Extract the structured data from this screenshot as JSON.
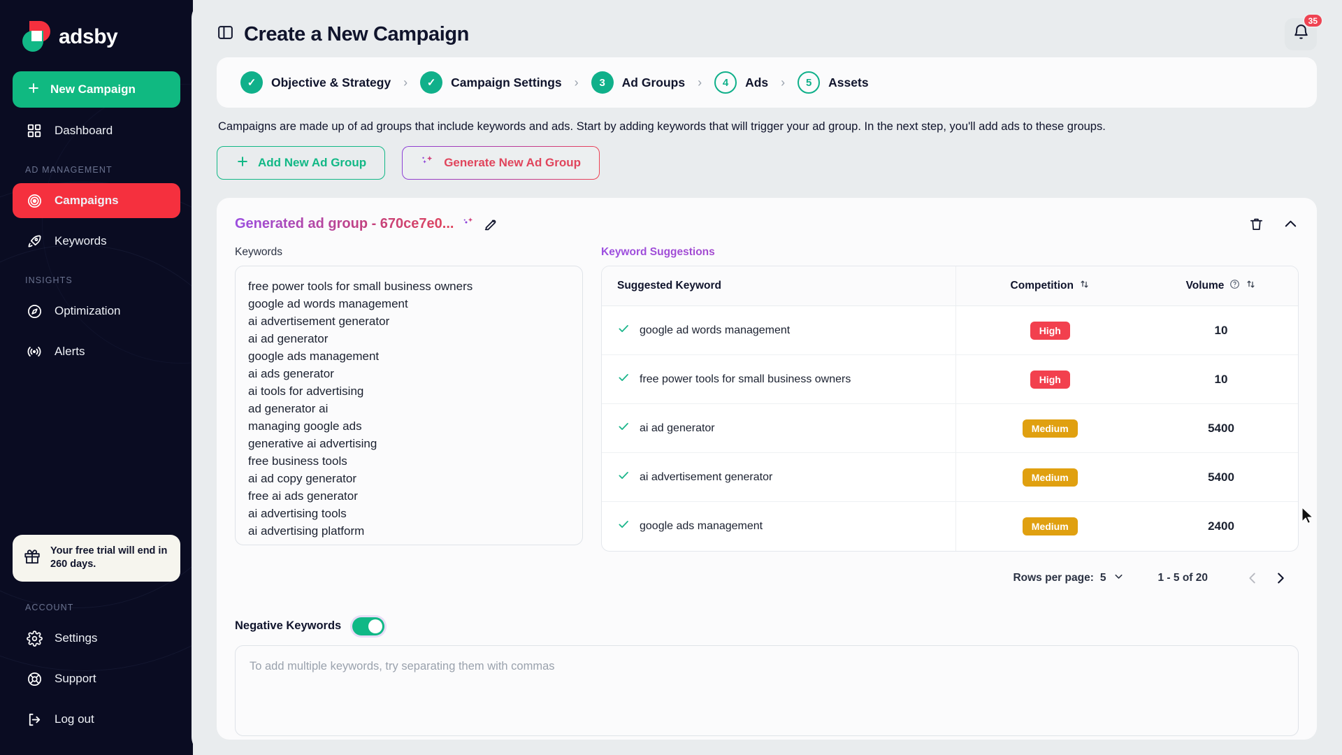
{
  "brand": {
    "name": "adsby",
    "logo_icon": "adsby-logo-icon"
  },
  "sidebar": {
    "new_campaign_label": "New Campaign",
    "items": [
      {
        "label": "Dashboard",
        "icon": "grid-icon"
      },
      {
        "label": "Campaigns",
        "icon": "target-icon"
      },
      {
        "label": "Keywords",
        "icon": "rocket-icon"
      },
      {
        "label": "Optimization",
        "icon": "compass-icon"
      },
      {
        "label": "Alerts",
        "icon": "broadcast-icon"
      },
      {
        "label": "Settings",
        "icon": "gear-icon"
      },
      {
        "label": "Support",
        "icon": "lifebuoy-icon"
      },
      {
        "label": "Log out",
        "icon": "logout-icon"
      }
    ],
    "sections": {
      "ad_management": "AD MANAGEMENT",
      "insights": "INSIGHTS",
      "account": "ACCOUNT"
    },
    "trial": {
      "text": "Your free trial will end in 260 days.",
      "icon": "gift-icon"
    },
    "active_item": "Campaigns"
  },
  "header": {
    "title": "Create a New Campaign",
    "panel_icon": "panel-toggle-icon",
    "bell_icon": "bell-icon",
    "notification_count": "35"
  },
  "stepper": {
    "separator": "›",
    "steps": [
      {
        "badge": "✓",
        "label": "Objective & Strategy",
        "state": "done"
      },
      {
        "badge": "✓",
        "label": "Campaign Settings",
        "state": "done"
      },
      {
        "badge": "3",
        "label": "Ad Groups",
        "state": "current"
      },
      {
        "badge": "4",
        "label": "Ads",
        "state": "todo"
      },
      {
        "badge": "5",
        "label": "Assets",
        "state": "todo"
      }
    ]
  },
  "description": "Campaigns are made up of ad groups that include keywords and ads. Start by adding keywords that will trigger your ad group. In the next step, you'll add ads to these groups.",
  "actions": {
    "add_label": "Add New Ad Group",
    "add_icon": "plus-icon",
    "generate_label": "Generate New Ad Group",
    "generate_icon": "sparkle-icon"
  },
  "ad_group": {
    "name": "Generated ad group - 670ce7e0...",
    "sparkle_icon": "sparkle-icon",
    "edit_icon": "pencil-edit-icon",
    "delete_icon": "trash-icon",
    "collapse_icon": "chevron-up-icon",
    "keywords_label": "Keywords",
    "keywords": [
      "free power tools for small business owners",
      "google ad words management",
      "ai advertisement generator",
      "ai ad generator",
      "google ads management",
      "ai ads generator",
      "ai tools for advertising",
      "ad generator ai",
      "managing google ads",
      "generative ai advertising",
      "free business tools",
      "ai ad copy generator",
      "free ai ads generator",
      "ai advertising tools",
      "ai advertising platform"
    ],
    "suggestions_label": "Keyword Suggestions",
    "table": {
      "columns": [
        "Suggested Keyword",
        "Competition",
        "Volume"
      ],
      "sort_icon": "sort-updown-icon",
      "help_icon": "help-circle-icon",
      "check_icon": "check-icon",
      "rows": [
        {
          "keyword": "google ad words management",
          "competition": "High",
          "competition_level": "high",
          "volume": "10"
        },
        {
          "keyword": "free power tools for small business owners",
          "competition": "High",
          "competition_level": "high",
          "volume": "10"
        },
        {
          "keyword": "ai ad generator",
          "competition": "Medium",
          "competition_level": "medium",
          "volume": "5400"
        },
        {
          "keyword": "ai advertisement generator",
          "competition": "Medium",
          "competition_level": "medium",
          "volume": "5400"
        },
        {
          "keyword": "google ads management",
          "competition": "Medium",
          "competition_level": "medium",
          "volume": "2400"
        }
      ]
    },
    "pagination": {
      "rows_per_page_label": "Rows per page:",
      "rows_per_page_value": "5",
      "range": "1 - 5 of 20",
      "prev_icon": "chevron-left-icon",
      "next_icon": "chevron-right-icon",
      "dropdown_icon": "chevron-down-icon"
    },
    "negative_keywords_label": "Negative Keywords",
    "negative_keywords_enabled": true,
    "negative_keywords_value": "",
    "negative_keywords_placeholder": "To add multiple keywords, try separating them with commas"
  },
  "colors": {
    "brand_green": "#10b981",
    "brand_red": "#f5303e",
    "sidebar_bg": "#0a0c22",
    "badge_high": "#f2404e",
    "badge_medium": "#e0a010",
    "accent_purple": "#9b4de0"
  }
}
